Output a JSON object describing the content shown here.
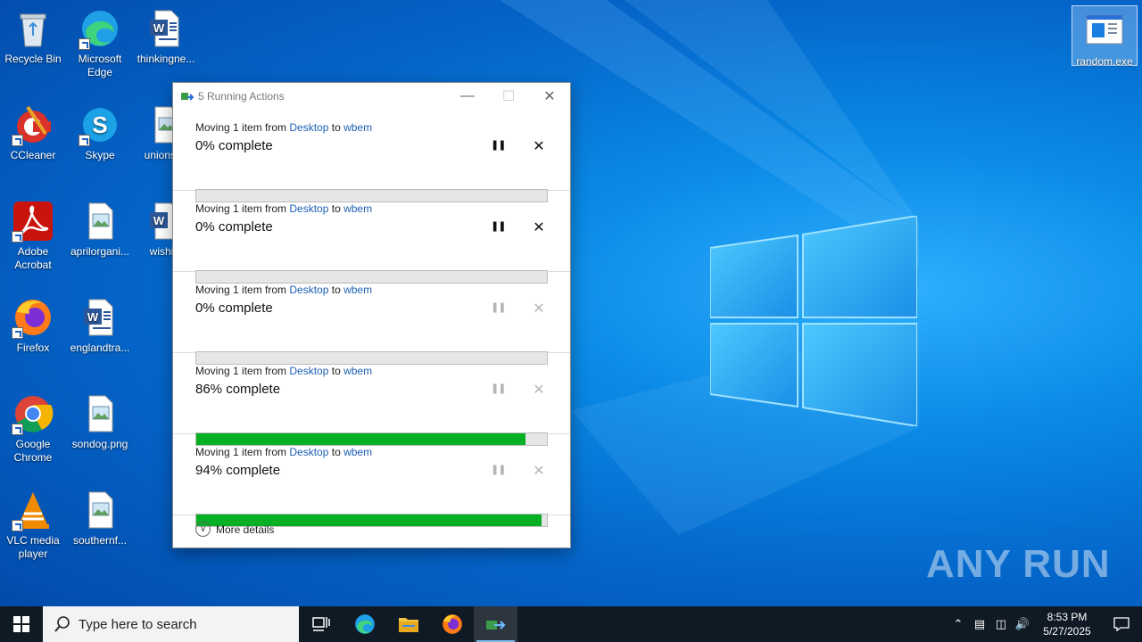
{
  "desktop": {
    "icons": [
      {
        "label": "Recycle Bin",
        "icon": "recycle-bin-icon"
      },
      {
        "label": "Microsoft Edge",
        "icon": "edge-icon"
      },
      {
        "label": "thinkingne...",
        "icon": "word-document-icon"
      },
      {
        "label": "CCleaner",
        "icon": "ccleaner-icon"
      },
      {
        "label": "Skype",
        "icon": "skype-icon"
      },
      {
        "label": "unionst...",
        "icon": "image-file-icon"
      },
      {
        "label": "Adobe Acrobat",
        "icon": "acrobat-icon"
      },
      {
        "label": "aprilorgani...",
        "icon": "image-file-icon"
      },
      {
        "label": "wishi...",
        "icon": "word-document-icon"
      },
      {
        "label": "Firefox",
        "icon": "firefox-icon"
      },
      {
        "label": "englandtra...",
        "icon": "word-document-icon"
      },
      {
        "label": "Google Chrome",
        "icon": "chrome-icon"
      },
      {
        "label": "sondog.png",
        "icon": "image-file-icon"
      },
      {
        "label": "VLC media player",
        "icon": "vlc-icon"
      },
      {
        "label": "southernf...",
        "icon": "image-file-icon"
      },
      {
        "label": "random.exe",
        "icon": "exe-file-icon"
      }
    ]
  },
  "dialog": {
    "title": "5 Running Actions",
    "operations": [
      {
        "prefix": "Moving 1 item from ",
        "source": "Desktop",
        "to": " to ",
        "dest": "wbem",
        "status": "0% complete",
        "progress": 0,
        "controls_enabled": true
      },
      {
        "prefix": "Moving 1 item from ",
        "source": "Desktop",
        "to": " to ",
        "dest": "wbem",
        "status": "0% complete",
        "progress": 0,
        "controls_enabled": true
      },
      {
        "prefix": "Moving 1 item from ",
        "source": "Desktop",
        "to": " to ",
        "dest": "wbem",
        "status": "0% complete",
        "progress": 0,
        "controls_enabled": false
      },
      {
        "prefix": "Moving 1 item from ",
        "source": "Desktop",
        "to": " to ",
        "dest": "wbem",
        "status": "86% complete",
        "progress": 0.94,
        "controls_enabled": false
      },
      {
        "prefix": "Moving 1 item from ",
        "source": "Desktop",
        "to": " to ",
        "dest": "wbem",
        "status": "94% complete",
        "progress": 0.985,
        "controls_enabled": false
      }
    ],
    "more_details": "More details"
  },
  "taskbar": {
    "search_placeholder": "Type here to search",
    "time": "8:53 PM",
    "date": "5/27/2025"
  },
  "watermark": "ANY RUN",
  "colors": {
    "progress": "#06b025",
    "link": "#1a5fb4",
    "taskbar": "#101a24"
  }
}
